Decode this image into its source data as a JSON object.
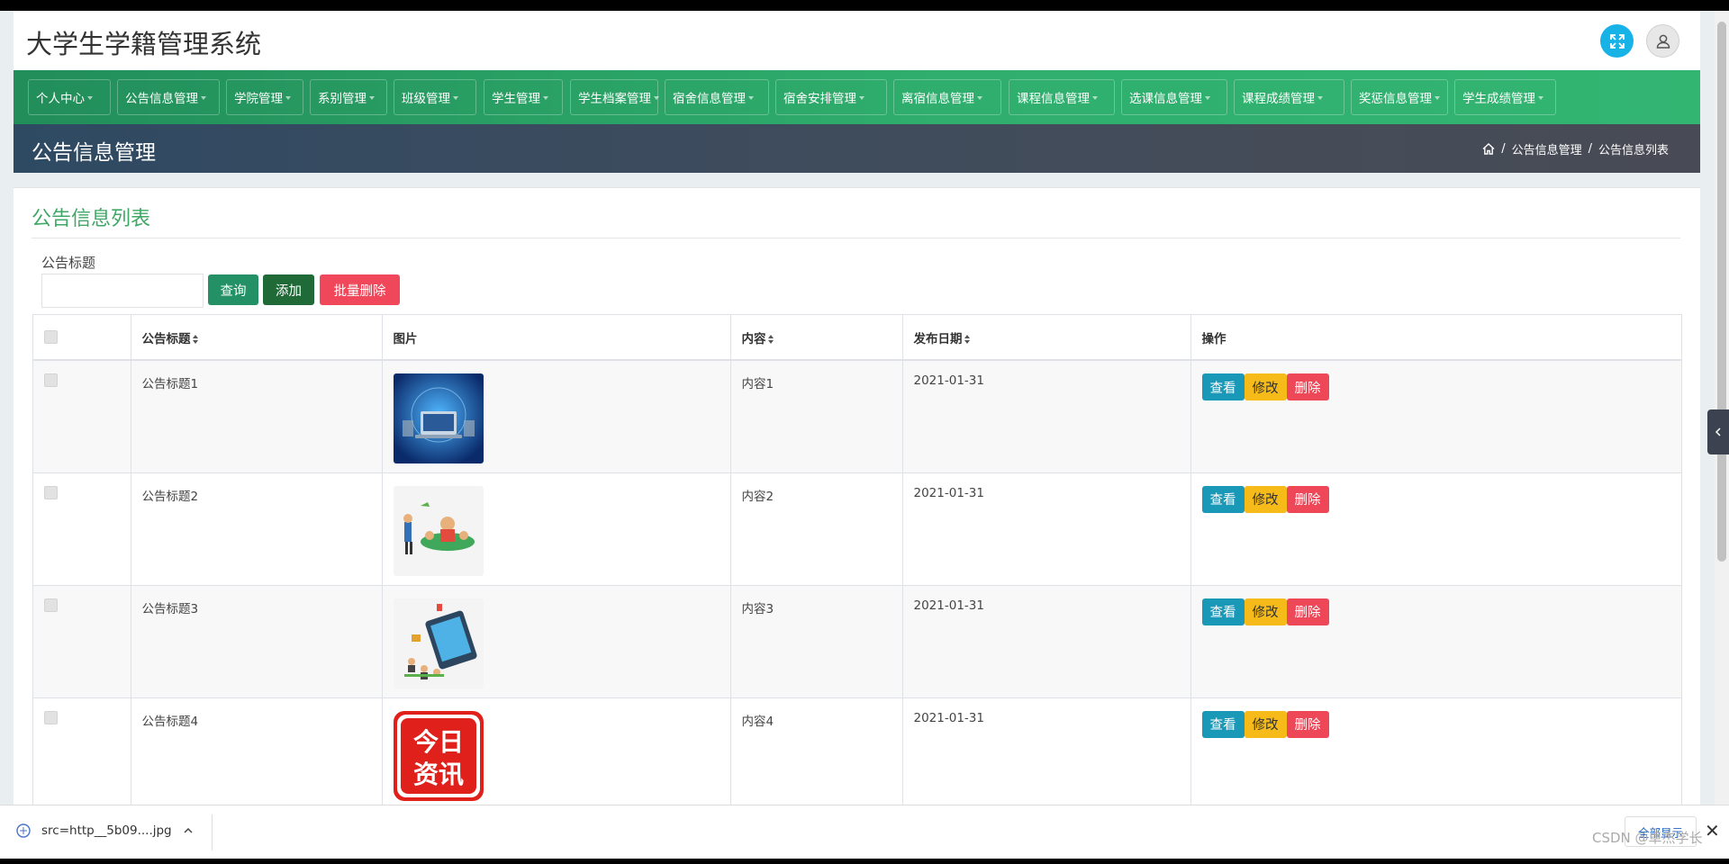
{
  "app": {
    "title": "大学生学籍管理系统"
  },
  "nav": {
    "items": [
      "个人中心",
      "公告信息管理",
      "学院管理",
      "系别管理",
      "班级管理",
      "学生管理",
      "学生档案管理",
      "宿舍信息管理",
      "宿舍安排管理",
      "离宿信息管理",
      "课程信息管理",
      "选课信息管理",
      "课程成绩管理",
      "奖惩信息管理",
      "学生成绩管理"
    ]
  },
  "banner": {
    "title": "公告信息管理",
    "breadcrumb": [
      "公告信息管理",
      "公告信息列表"
    ]
  },
  "list": {
    "title": "公告信息列表",
    "filter_label": "公告标题",
    "filter_value": "",
    "buttons": {
      "query": "查询",
      "add": "添加",
      "batch_delete": "批量删除"
    },
    "columns": {
      "title": "公告标题",
      "image": "图片",
      "content": "内容",
      "date": "发布日期",
      "actions": "操作"
    },
    "actions": {
      "view": "查看",
      "edit": "修改",
      "delete": "删除"
    },
    "rows": [
      {
        "title": "公告标题1",
        "image": "network-computer-image",
        "content": "内容1",
        "date": "2021-01-31"
      },
      {
        "title": "公告标题2",
        "image": "classroom-illustration-image",
        "content": "内容2",
        "date": "2021-01-31"
      },
      {
        "title": "公告标题3",
        "image": "online-class-illustration-image",
        "content": "内容3",
        "date": "2021-01-31"
      },
      {
        "title": "公告标题4",
        "image": "news-app-logo-image",
        "content": "内容4",
        "date": "2021-01-31"
      }
    ],
    "logo_text": [
      "今日",
      "资讯"
    ]
  },
  "download": {
    "file": "src=http__5b09....jpg",
    "show_all": "全部显示"
  },
  "watermark": "CSDN @卓杰学长",
  "colors": {
    "nav_green": "#2fae6d",
    "title_green": "#3fa866",
    "view": "#1a98b8",
    "edit": "#f6bb19",
    "delete": "#ee4757"
  }
}
